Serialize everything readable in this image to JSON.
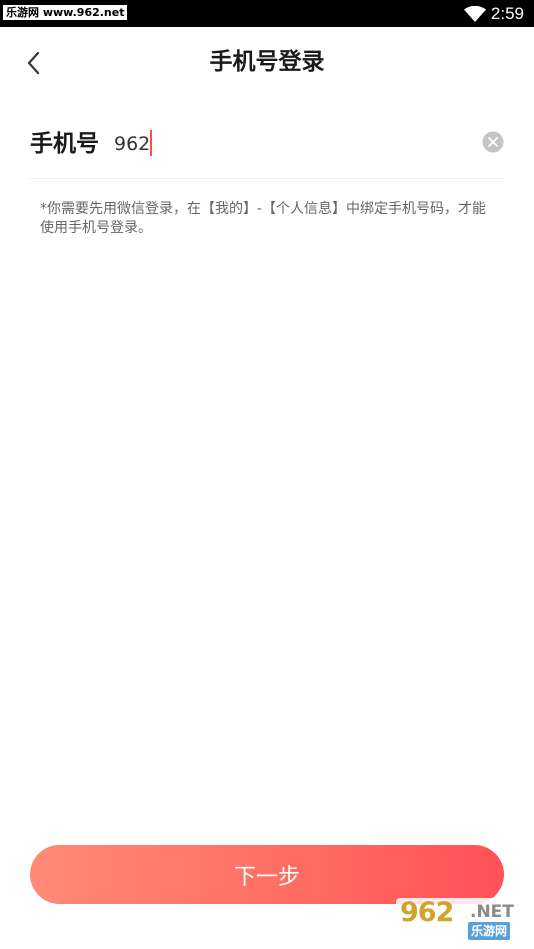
{
  "status_bar": {
    "watermark": "乐游网 www.962.net",
    "time": "2:59"
  },
  "header": {
    "title": "手机号登录",
    "back_icon": "chevron-left-icon"
  },
  "phone_form": {
    "label": "手机号",
    "value": "962",
    "placeholder": "",
    "clear_icon": "clear-circle-icon"
  },
  "hint": {
    "text": "*你需要先用微信登录，在【我的】-【个人信息】中绑定手机号码，才能使用手机号登录。"
  },
  "next_button": {
    "label": "下一步"
  },
  "logo": {
    "main": "962",
    "net": ".NET",
    "sub": "乐游网"
  },
  "colors": {
    "accent_start": "#ff8a77",
    "accent_end": "#ff5157",
    "caret": "#ff4d4d"
  }
}
